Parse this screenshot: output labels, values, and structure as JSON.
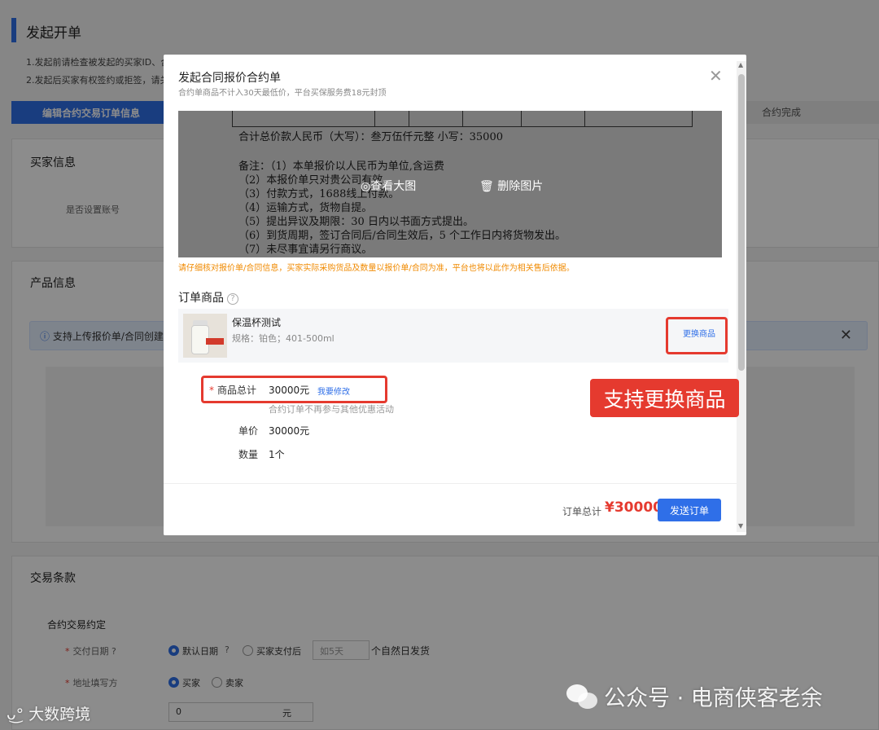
{
  "background": {
    "page_title": "发起开单",
    "notes": [
      "1.发起前请检查被发起的买家ID、合",
      "2.发起后买家有权签约或拒签，请关"
    ],
    "steps": {
      "active": "编辑合约交易订单信息",
      "done": "合约完成"
    },
    "buyer_section": {
      "title": "买家信息",
      "account_label": "是否设置账号"
    },
    "product_section": {
      "title": "产品信息",
      "info_text": "支持上传报价单/合同创建"
    },
    "trade_section": {
      "title": "交易条款",
      "subtitle": "合约交易约定",
      "delivery_label": "交付日期",
      "option_default": "默认日期",
      "option_after_pay": "买家支付后",
      "days_placeholder": "如5天",
      "days_suffix": "个自然日发货",
      "address_label": "地址填写方",
      "option_buyer": "买家",
      "option_seller": "卖家",
      "amount_value": "0",
      "amount_unit": "元"
    }
  },
  "modal": {
    "title": "发起合同报价合约单",
    "subtitle": "合约单商品不计入30天最低价，平台买保服务费18元封顶",
    "document_lines": [
      "合计总价款人民币（大写）：叁万伍仟元整          小写：35000",
      "备注：（1）本单报价以人民币为单位,含运费",
      "      （2）本报价单只对贵公司有效。",
      "      （3）付款方式，1688线上付款。",
      "      （4）运输方式，货物自提。",
      "      （5）提出异议及期限：30 日内以书面方式提出。",
      "      （6）到货周期，签订合同后/合同生效后，5 个工作日内将货物发出。",
      "      （7）未尽事宜请另行商议。"
    ],
    "view_image": "查看大图",
    "delete_image": "删除图片",
    "warning": "请仔细核对报价单/合同信息，买家实际采购货品及数量以报价单/合同为准，平台也将以此作为相关售后依据。",
    "order_goods_title": "订单商品",
    "product": {
      "name": "保温杯测试",
      "spec": "规格：铂色；401-500ml",
      "change_label": "更换商品"
    },
    "fields": {
      "total_label": "商品总计",
      "total_value": "30000元",
      "modify_label": "我要修改",
      "hint": "合约订单不再参与其他优惠活动",
      "unit_price_label": "单价",
      "unit_price_value": "30000元",
      "quantity_label": "数量",
      "quantity_value": "1个"
    },
    "footer": {
      "total_label": "订单总计",
      "total_value": "¥30000",
      "send_label": "发送订单"
    }
  },
  "callout": "支持更换商品",
  "watermarks": {
    "right": "公众号 · 电商侠客老余",
    "left": "大数跨境"
  },
  "colors": {
    "primary": "#2f6fe8",
    "highlight": "#e53a2f",
    "warning": "#f08a00"
  }
}
